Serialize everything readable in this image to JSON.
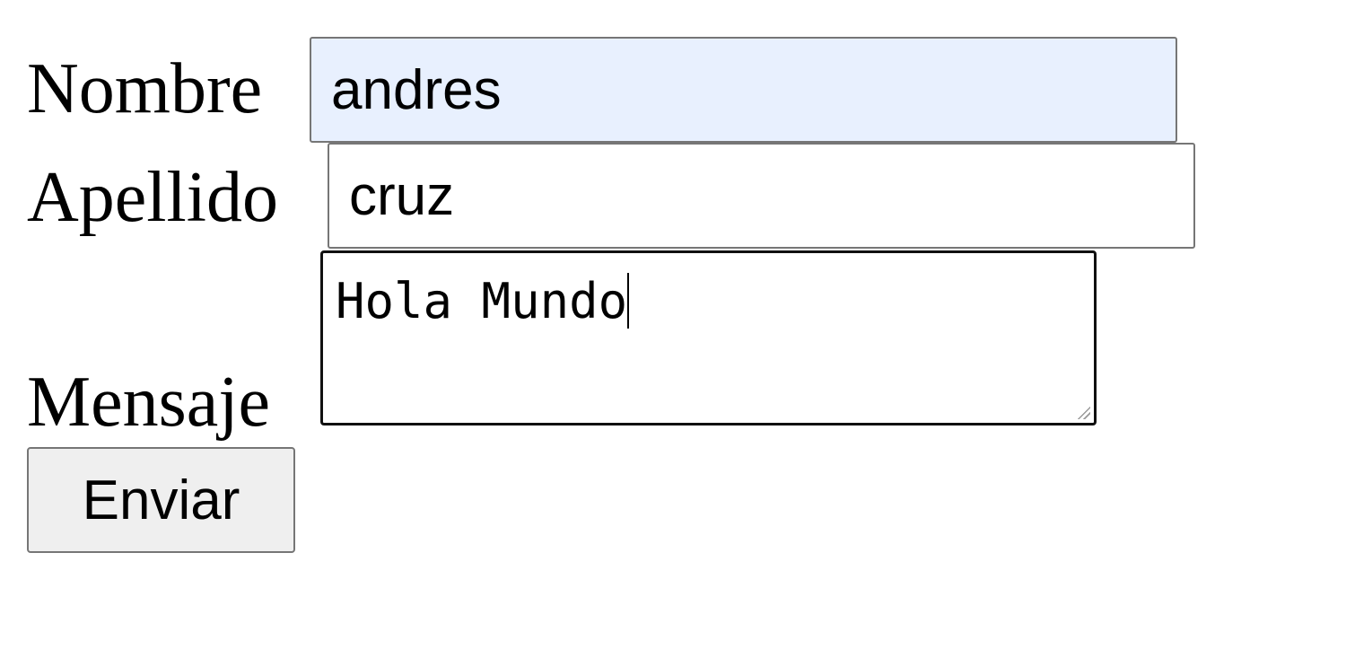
{
  "form": {
    "nombre": {
      "label": "Nombre",
      "value": "andres",
      "autofill_bg": "#e8f0fe"
    },
    "apellido": {
      "label": "Apellido",
      "value": "cruz"
    },
    "mensaje": {
      "label": "Mensaje",
      "value": "Hola Mundo"
    },
    "submit_label": "Enviar"
  }
}
